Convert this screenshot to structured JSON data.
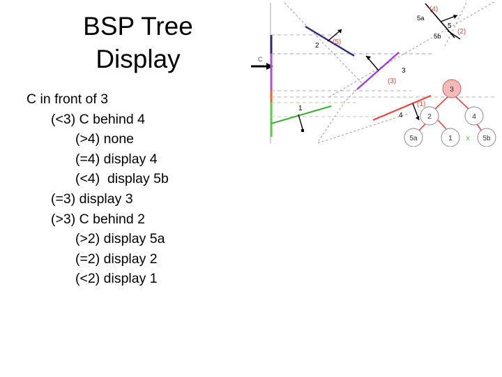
{
  "slide": {
    "title": "BSP Tree\nDisplay",
    "background": "#ffffff"
  },
  "outline": {
    "lines": [
      {
        "text": "C in front of 3",
        "indent": 0
      },
      {
        "text": "(<3) C behind 4",
        "indent": 1
      },
      {
        "text": "(>4) none",
        "indent": 2
      },
      {
        "text": "(=4) display 4",
        "indent": 2
      },
      {
        "text": "(<4)  display 5b",
        "indent": 2
      },
      {
        "text": "(=3) display 3",
        "indent": 1
      },
      {
        "text": "(>3) C behind 2",
        "indent": 1
      },
      {
        "text": "(>2) display 5a",
        "indent": 2
      },
      {
        "text": "(=2) display 2",
        "indent": 2
      },
      {
        "text": "(<2) display 1",
        "indent": 2
      }
    ]
  },
  "diagram": {
    "viewer_label": "C",
    "colors": {
      "navy": "#2a2a7a",
      "violet": "#b04bdb",
      "purple": "#8b2fd0",
      "orange": "#e8622a",
      "green": "#3cb034",
      "red": "#e8473f",
      "gray": "#909090",
      "label_red": "#e8473f",
      "node_stroke": "#8a8a8a",
      "node_highlight": "#f7b8b8",
      "x_green": "#55bb44"
    },
    "segments": [
      {
        "name": "seg-2",
        "label": "2",
        "order": "(5)",
        "color": "navy"
      },
      {
        "name": "seg-3",
        "label": "3",
        "order": "(3)",
        "color": "violet"
      },
      {
        "name": "seg-1",
        "label": "1",
        "order": "(1)",
        "color": "green"
      },
      {
        "name": "seg-4",
        "label": "4",
        "order": "(1)",
        "color": "red"
      },
      {
        "name": "seg-5",
        "label": "5",
        "order": "(2)",
        "color": "black"
      },
      {
        "name": "seg-5a",
        "label": "5a",
        "order": "(4)",
        "color": "black"
      },
      {
        "name": "seg-5b",
        "label": "5b",
        "order": "",
        "color": "black"
      }
    ],
    "order_labels": [
      "(5)",
      "(3)",
      "(1)",
      "(2)",
      "(4)"
    ],
    "segment_labels": [
      "2",
      "3",
      "1",
      "4",
      "5",
      "5a",
      "5b"
    ],
    "tree": {
      "root": "3",
      "level2": [
        "2",
        "4"
      ],
      "level3": [
        "5a",
        "1",
        "5b"
      ],
      "marker": "x"
    }
  }
}
